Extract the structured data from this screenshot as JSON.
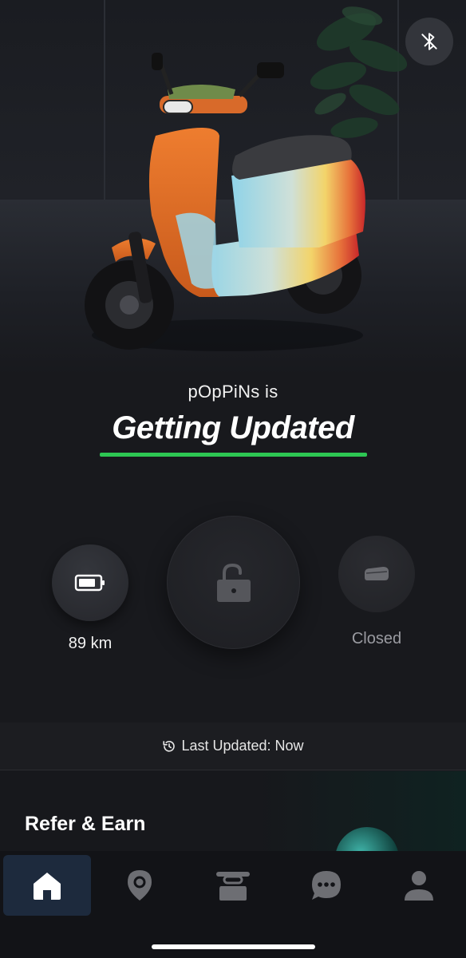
{
  "hero": {
    "vehicle_name": "pOpPiNs is",
    "status_title": "Getting Updated"
  },
  "controls": {
    "range_value": "89 km",
    "lock_state": "unlocked",
    "seat_label": "Closed"
  },
  "update_status": {
    "text": "Last Updated: Now"
  },
  "promo": {
    "title": "Refer & Earn"
  },
  "tabs": [
    {
      "name": "home",
      "icon": "home-icon",
      "active": true
    },
    {
      "name": "location",
      "icon": "location-pin-icon",
      "active": false
    },
    {
      "name": "scooter",
      "icon": "scooter-icon",
      "active": false
    },
    {
      "name": "chat",
      "icon": "chat-icon",
      "active": false
    },
    {
      "name": "profile",
      "icon": "profile-icon",
      "active": false
    }
  ],
  "colors": {
    "accent_green": "#2dc653",
    "active_tab": "#1d2a3d",
    "background": "#18191d"
  }
}
